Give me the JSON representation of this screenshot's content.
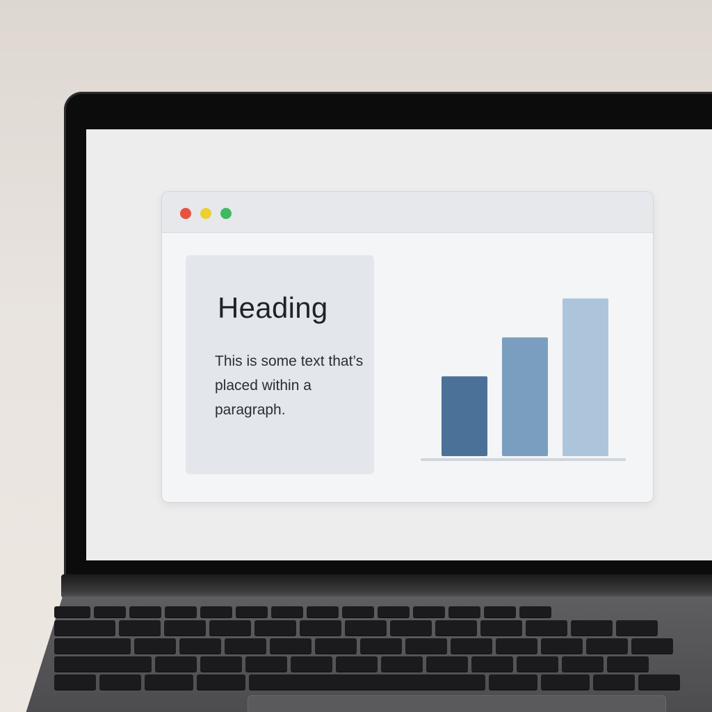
{
  "window": {
    "controls": [
      {
        "name": "close",
        "color": "#e8533f"
      },
      {
        "name": "minimize",
        "color": "#ecd033"
      },
      {
        "name": "maximize",
        "color": "#3fba62"
      }
    ]
  },
  "card": {
    "heading": "Heading",
    "paragraph": "This is some text that’s placed within a paragraph."
  },
  "chart_data": {
    "type": "bar",
    "categories": [
      "",
      "",
      ""
    ],
    "values": [
      41,
      61,
      81
    ],
    "colors": [
      "#4c7198",
      "#7a9ebf",
      "#adc5db"
    ],
    "ylim": [
      0,
      100
    ],
    "baseline_color": "#cfd5dc",
    "grid": false
  }
}
